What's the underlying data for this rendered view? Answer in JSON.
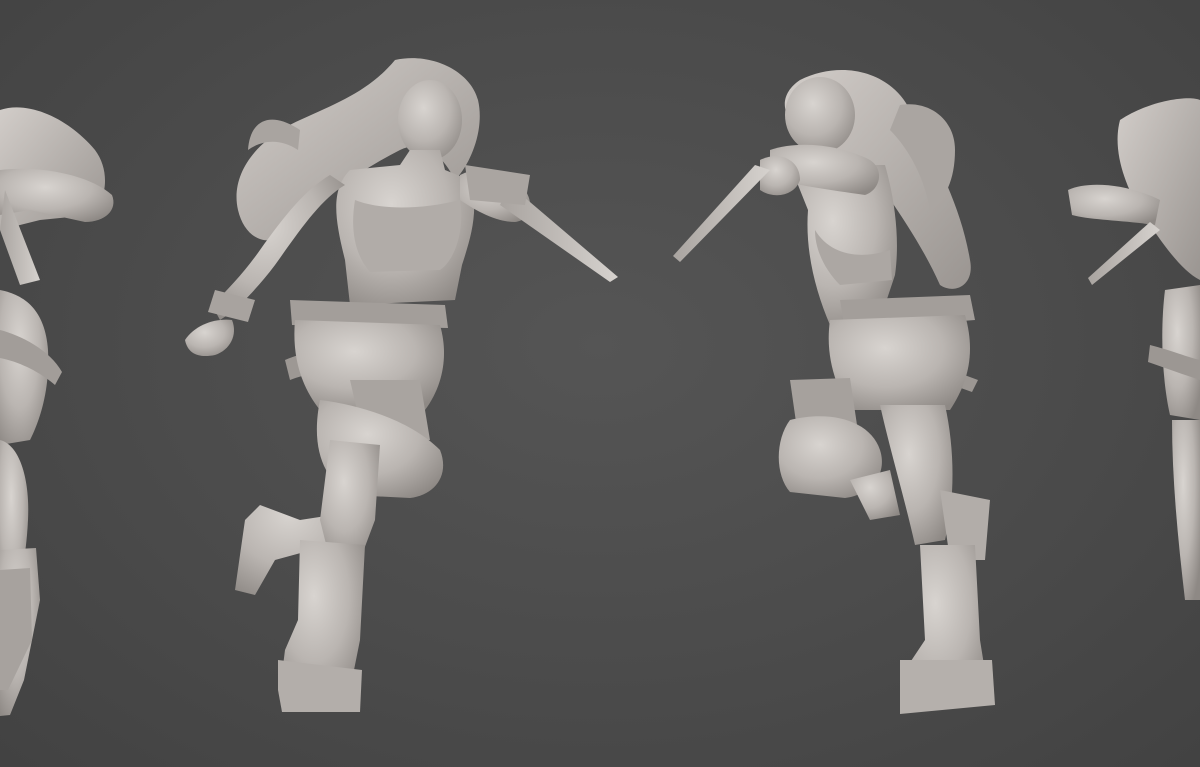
{
  "scene": {
    "description_name": "turnaround-sculpt-render",
    "background_color": "#4a4a4a",
    "material_color": "#bdb8b4",
    "views": [
      {
        "id": "back-left",
        "label": ""
      },
      {
        "id": "front-three-quarter",
        "label": ""
      },
      {
        "id": "back-three-quarter",
        "label": ""
      },
      {
        "id": "back-right",
        "label": ""
      }
    ]
  }
}
